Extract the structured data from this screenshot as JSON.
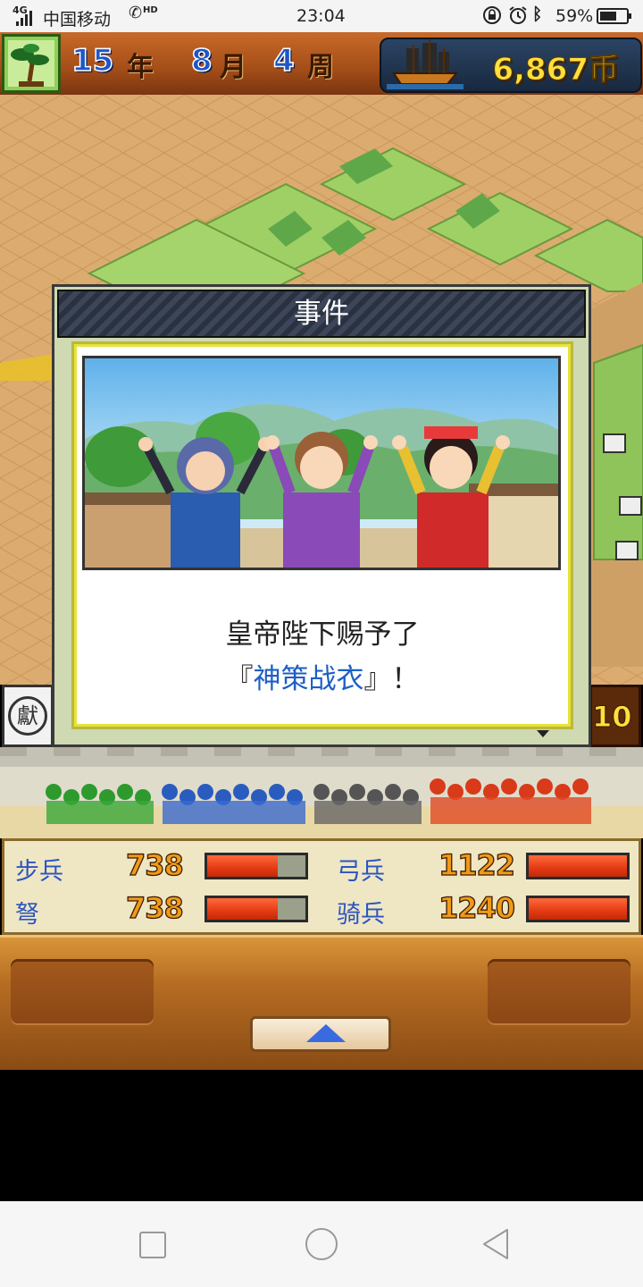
{
  "status_bar": {
    "network": "4G",
    "carrier": "中国移动",
    "hd": "HD",
    "time": "23:04",
    "battery": "59%"
  },
  "header": {
    "year": "15",
    "year_unit": "年",
    "month": "8",
    "month_unit": "月",
    "week": "4",
    "week_unit": "周",
    "coins": "6,867币"
  },
  "dialog": {
    "title": "事件",
    "message_line1": "皇帝陛下赐予了",
    "message_line2_open": "『",
    "message_item": "神策战衣",
    "message_line2_close": "』！",
    "item_color": "#1d5fc4"
  },
  "side_widgets": {
    "left_badge": "獻",
    "right_value": "10"
  },
  "troops": [
    {
      "label": "步兵",
      "value": "738",
      "fill": 0.72
    },
    {
      "label": "弓兵",
      "value": "1122",
      "fill": 1.0
    },
    {
      "label": "弩",
      "value": "738",
      "fill": 0.72
    },
    {
      "label": "骑兵",
      "value": "1240",
      "fill": 1.0
    }
  ],
  "colors": {
    "label_blue": "#2c55c0",
    "value_orange": "#f09a18",
    "bar_red": "#e43a14",
    "coin_yellow": "#ffe03a"
  },
  "icons": [
    "bonsai-icon",
    "ship-icon",
    "up-arrow-icon",
    "alarm-icon",
    "bluetooth-icon",
    "lock-icon",
    "battery-icon",
    "back-icon",
    "home-icon",
    "recents-icon"
  ]
}
